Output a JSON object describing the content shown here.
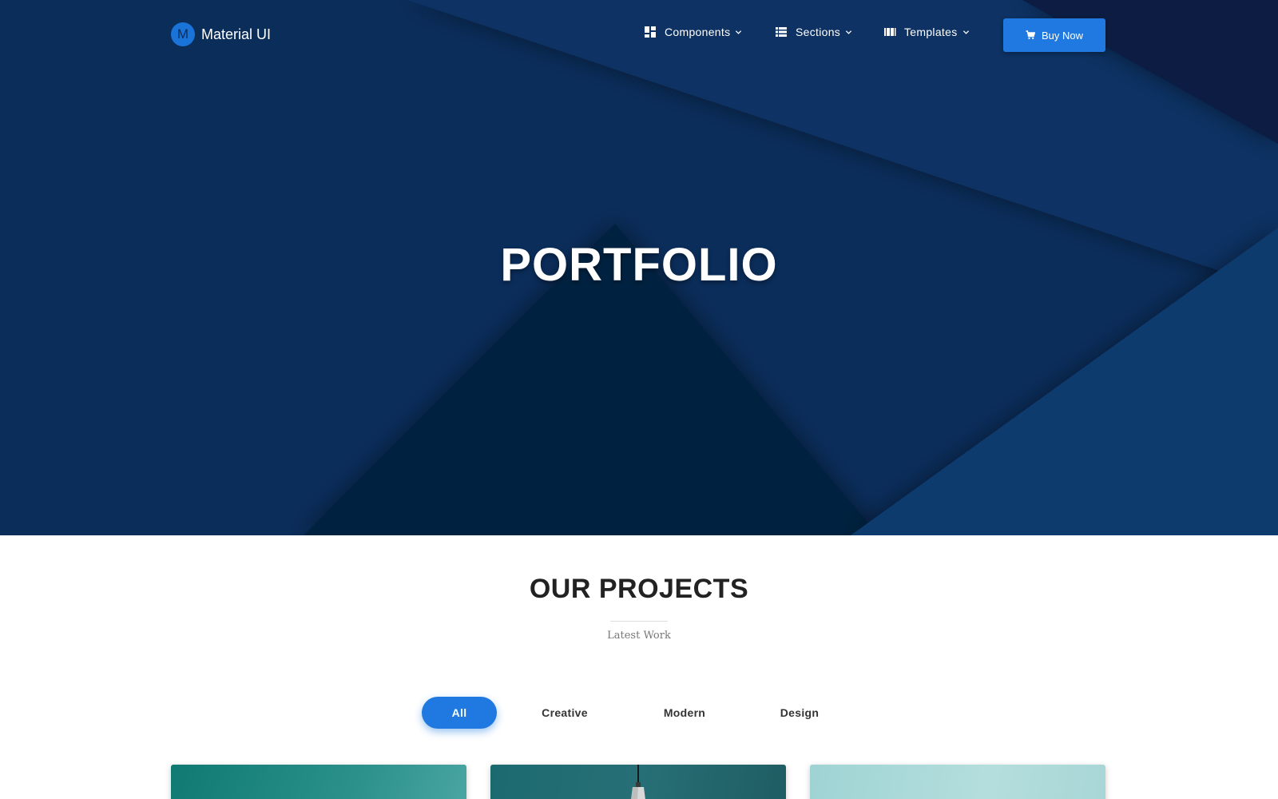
{
  "brand": {
    "mark": "M",
    "name": "Material UI"
  },
  "nav": {
    "items": [
      {
        "label": "Components",
        "icon": "dashboard-icon"
      },
      {
        "label": "Sections",
        "icon": "list-icon"
      },
      {
        "label": "Templates",
        "icon": "view-column-icon"
      }
    ],
    "buy_label": "Buy Now",
    "buy_icon": "cart-icon"
  },
  "hero": {
    "title": "PORTFOLIO"
  },
  "projects": {
    "title": "OUR PROJECTS",
    "subtitle": "Latest Work",
    "filters": [
      {
        "label": "All",
        "active": true
      },
      {
        "label": "Creative",
        "active": false
      },
      {
        "label": "Modern",
        "active": false
      },
      {
        "label": "Design",
        "active": false
      }
    ]
  },
  "colors": {
    "accent": "#1f79e0",
    "hero_dark": "#0b2d5a"
  }
}
